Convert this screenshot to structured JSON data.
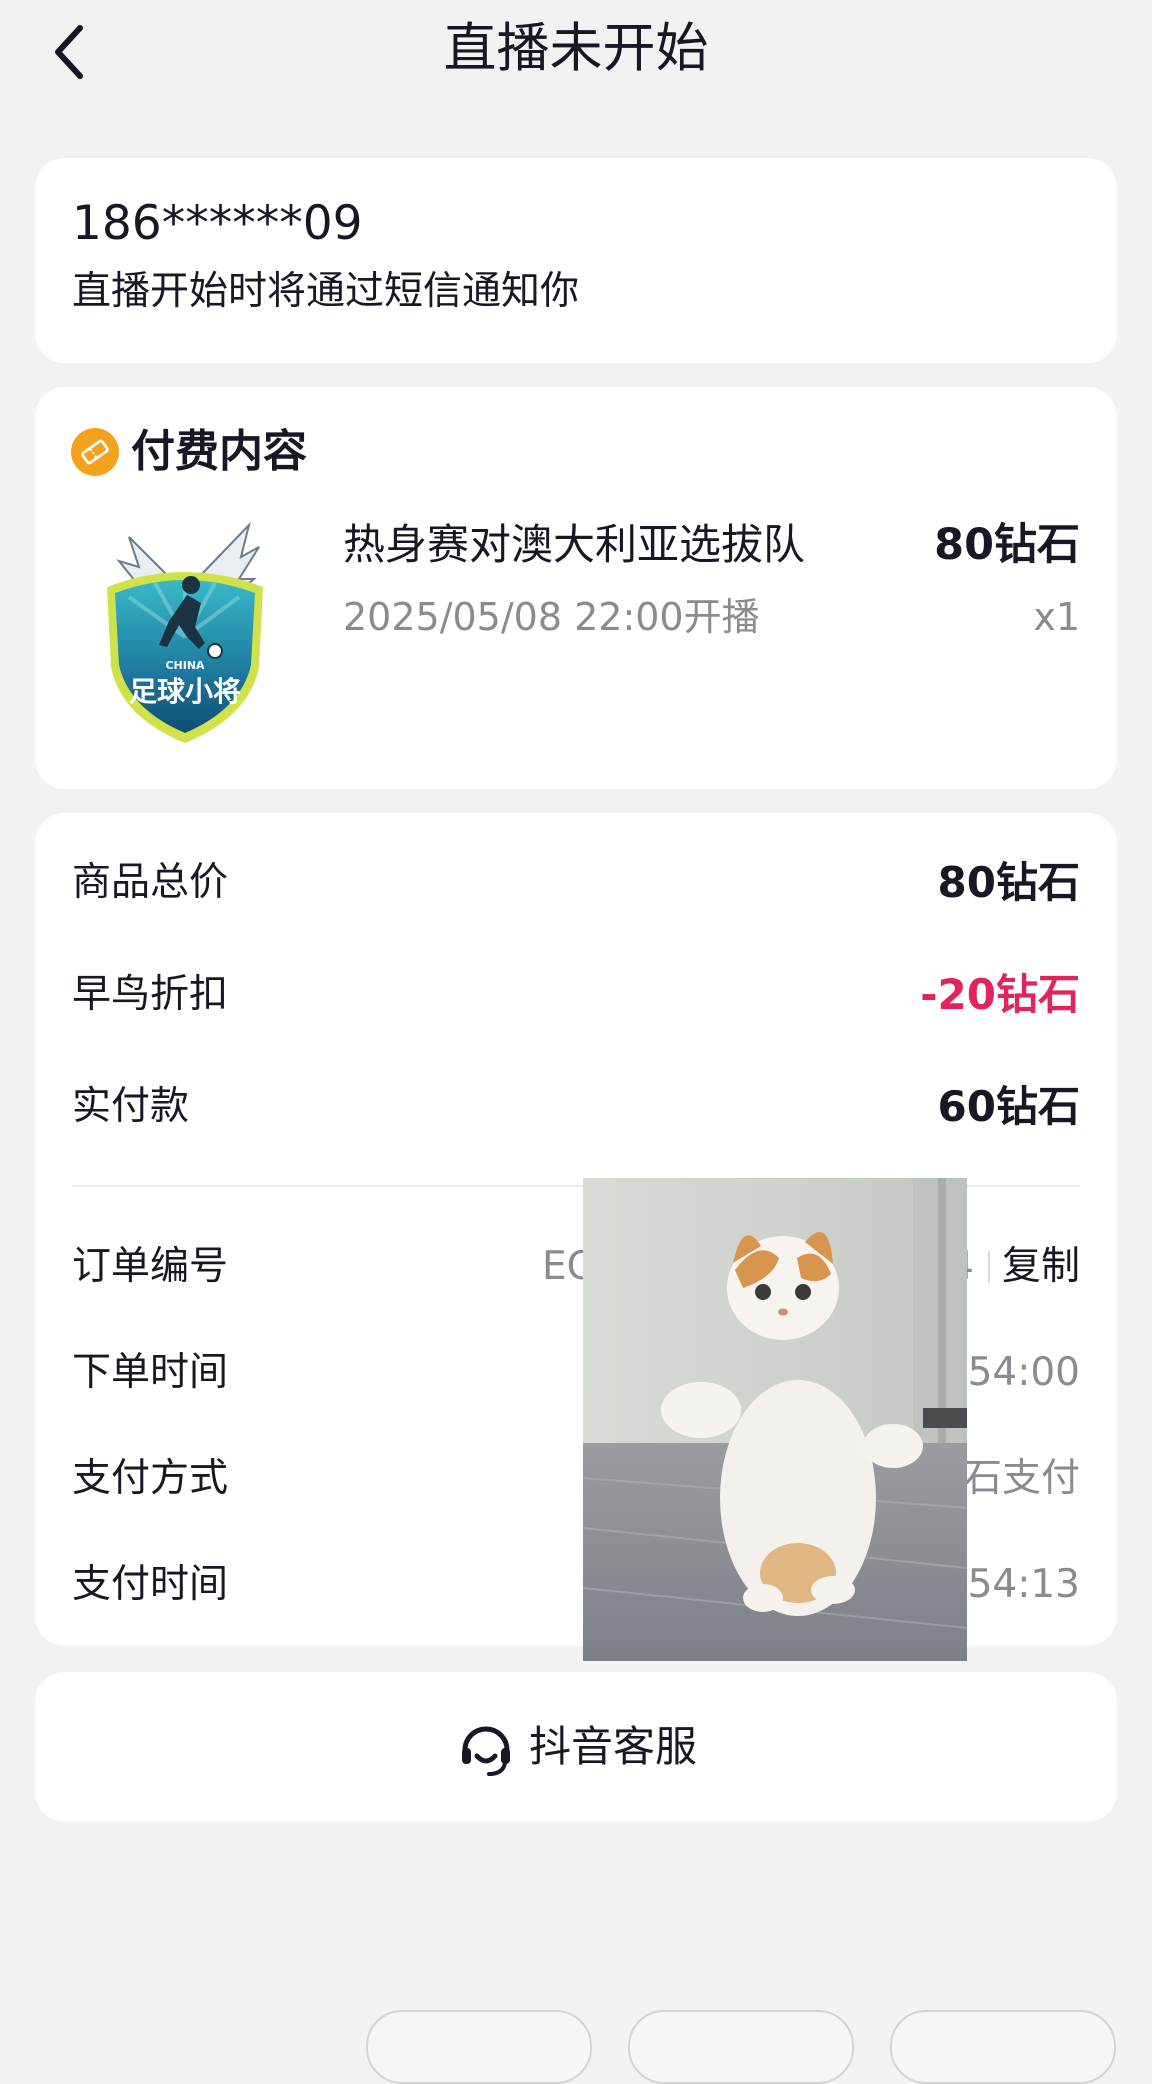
{
  "header": {
    "title": "直播未开始",
    "back_icon": "chevron-left-icon"
  },
  "notice": {
    "phone": "186******09",
    "text": "直播开始时将通过短信通知你"
  },
  "paid_content": {
    "section_title": "付费内容",
    "section_icon": "ticket-icon",
    "item": {
      "name": "热身赛对澳大利亚选拔队",
      "time": "2025/05/08 22:00开播",
      "price": "80钻石",
      "quantity": "x1",
      "logo_text": "足球小将",
      "logo_caption": "CHINA"
    }
  },
  "summary": {
    "rows": [
      {
        "label": "商品总价",
        "value": "80钻石"
      },
      {
        "label": "早鸟折扣",
        "value": "-20钻石"
      },
      {
        "label": "实付款",
        "value": "60钻石"
      }
    ]
  },
  "order": {
    "number_label": "订单编号",
    "number_value": "EO1",
    "number_value_tail": "4",
    "copy_label": "复制",
    "time_label": "下单时间",
    "time_value": ":54:00",
    "pay_method_label": "支付方式",
    "pay_method_value": "石支付",
    "pay_time_label": "支付时间",
    "pay_time_value": ":54:13"
  },
  "service": {
    "label": "抖音客服",
    "icon": "headset-icon"
  },
  "colors": {
    "accent_red": "#e1245c",
    "ticket_orange": "#f4a21e",
    "background": "#f2f2f2"
  }
}
